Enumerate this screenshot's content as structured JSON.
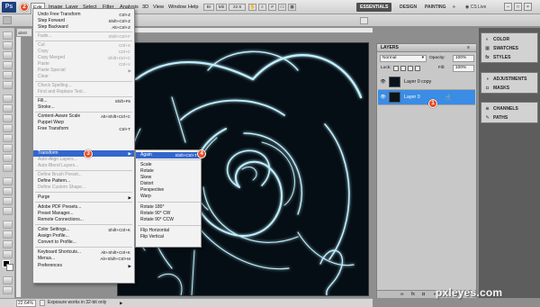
{
  "menubar": {
    "logo": "Ps",
    "items": [
      "Edit",
      "Image",
      "Layer",
      "Select",
      "Filter",
      "Analysis",
      "3D",
      "View",
      "Window",
      "Help"
    ],
    "zoom_value": "22.6",
    "workspaces": [
      "ESSENTIALS",
      "DESIGN",
      "PAINTING"
    ],
    "overflow": "»",
    "cs_live": "CS Live"
  },
  "document": {
    "tab_label": "abstr"
  },
  "edit_menu": {
    "undo": {
      "label": "Undo Free Transform",
      "shortcut": "Ctrl+Z"
    },
    "step_forward": {
      "label": "Step Forward",
      "shortcut": "Shift+Ctrl+Z"
    },
    "step_backward": {
      "label": "Step Backward",
      "shortcut": "Alt+Ctrl+Z"
    },
    "fade": {
      "label": "Fade...",
      "shortcut": "Shift+Ctrl+F"
    },
    "cut": {
      "label": "Cut",
      "shortcut": "Ctrl+X"
    },
    "copy": {
      "label": "Copy",
      "shortcut": "Ctrl+C"
    },
    "copy_merged": {
      "label": "Copy Merged",
      "shortcut": "Shift+Ctrl+C"
    },
    "paste": {
      "label": "Paste",
      "shortcut": "Ctrl+V"
    },
    "paste_special": {
      "label": "Paste Special"
    },
    "clear": {
      "label": "Clear"
    },
    "check_spelling": {
      "label": "Check Spelling..."
    },
    "find_replace": {
      "label": "Find and Replace Text..."
    },
    "fill": {
      "label": "Fill...",
      "shortcut": "Shift+F5"
    },
    "stroke": {
      "label": "Stroke..."
    },
    "content_aware_scale": {
      "label": "Content-Aware Scale",
      "shortcut": "Alt+Shift+Ctrl+C"
    },
    "puppet_warp": {
      "label": "Puppet Warp"
    },
    "free_transform": {
      "label": "Free Transform",
      "shortcut": "Ctrl+T"
    },
    "transform": {
      "label": "Transform"
    },
    "auto_align": {
      "label": "Auto-Align Layers..."
    },
    "auto_blend": {
      "label": "Auto-Blend Layers..."
    },
    "define_brush": {
      "label": "Define Brush Preset..."
    },
    "define_pattern": {
      "label": "Define Pattern..."
    },
    "define_shape": {
      "label": "Define Custom Shape..."
    },
    "purge": {
      "label": "Purge"
    },
    "pdf_presets": {
      "label": "Adobe PDF Presets..."
    },
    "preset_manager": {
      "label": "Preset Manager..."
    },
    "remote_connections": {
      "label": "Remote Connections..."
    },
    "color_settings": {
      "label": "Color Settings...",
      "shortcut": "Shift+Ctrl+K"
    },
    "assign_profile": {
      "label": "Assign Profile..."
    },
    "convert_profile": {
      "label": "Convert to Profile..."
    },
    "keyboard_shortcuts": {
      "label": "Keyboard Shortcuts...",
      "shortcut": "Alt+Shift+Ctrl+K"
    },
    "menus": {
      "label": "Menus...",
      "shortcut": "Alt+Shift+Ctrl+M"
    },
    "preferences": {
      "label": "Preferences"
    }
  },
  "transform_submenu": {
    "again": {
      "label": "Again",
      "shortcut": "Shift+Ctrl+T"
    },
    "scale": "Scale",
    "rotate": "Rotate",
    "skew": "Skew",
    "distort": "Distort",
    "perspective": "Perspective",
    "warp": "Warp",
    "rotate_180": "Rotate 180°",
    "rotate_90_cw": "Rotate 90° CW",
    "rotate_90_ccw": "Rotate 90° CCW",
    "flip_horizontal": "Flip Horizontal",
    "flip_vertical": "Flip Vertical"
  },
  "layers_panel": {
    "title": "LAYERS",
    "blend_mode": "Normal",
    "opacity_label": "Opacity:",
    "opacity_value": "100%",
    "lock_label": "Lock:",
    "fill_label": "Fill:",
    "fill_value": "100%",
    "layers": [
      {
        "name": "Layer 0 copy",
        "selected": false
      },
      {
        "name": "Layer 0",
        "selected": true
      }
    ]
  },
  "dock": {
    "groups": [
      [
        "COLOR",
        "SWATCHES",
        "STYLES"
      ],
      [
        "ADJUSTMENTS",
        "MASKS"
      ],
      [
        "CHANNELS",
        "PATHS"
      ]
    ]
  },
  "statusbar": {
    "zoom": "22.64%",
    "message": "Exposure works in 32-bit only"
  },
  "steps": [
    "1",
    "2",
    "3",
    "4"
  ],
  "watermark": "pxleyes.com",
  "colors": {
    "highlight": "#3366cc",
    "layer_selected": "#3b8ce5",
    "step_badge": "#e84b24",
    "canvas_bg": "#050e14"
  }
}
